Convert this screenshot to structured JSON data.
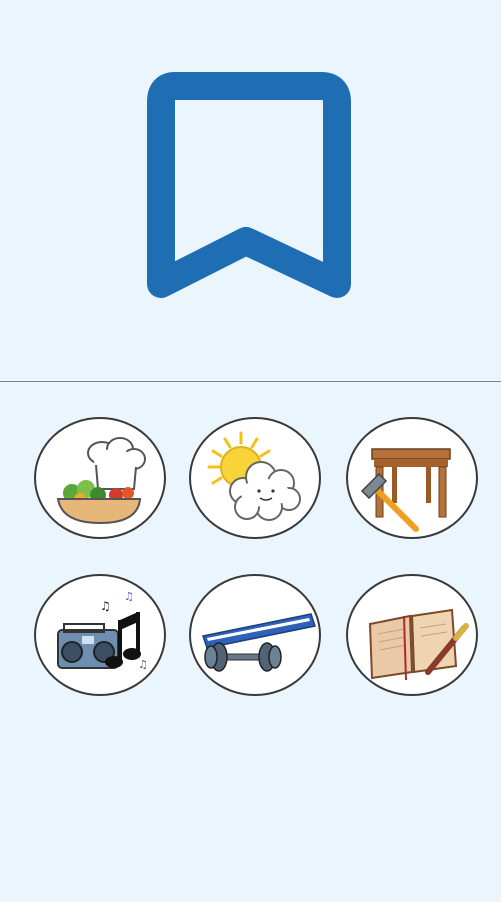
{
  "bookmark": {
    "icon": "bookmark-outline-icon",
    "color": "#1f6db3"
  },
  "categories": [
    {
      "icon": "cooking-icon"
    },
    {
      "icon": "weather-icon"
    },
    {
      "icon": "woodworking-icon"
    },
    {
      "icon": "music-icon"
    },
    {
      "icon": "fitness-icon"
    },
    {
      "icon": "writing-icon"
    }
  ],
  "colors": {
    "background": "#eaf5fd",
    "divider": "#7a7f83",
    "tile_border": "#3a3a3a"
  }
}
